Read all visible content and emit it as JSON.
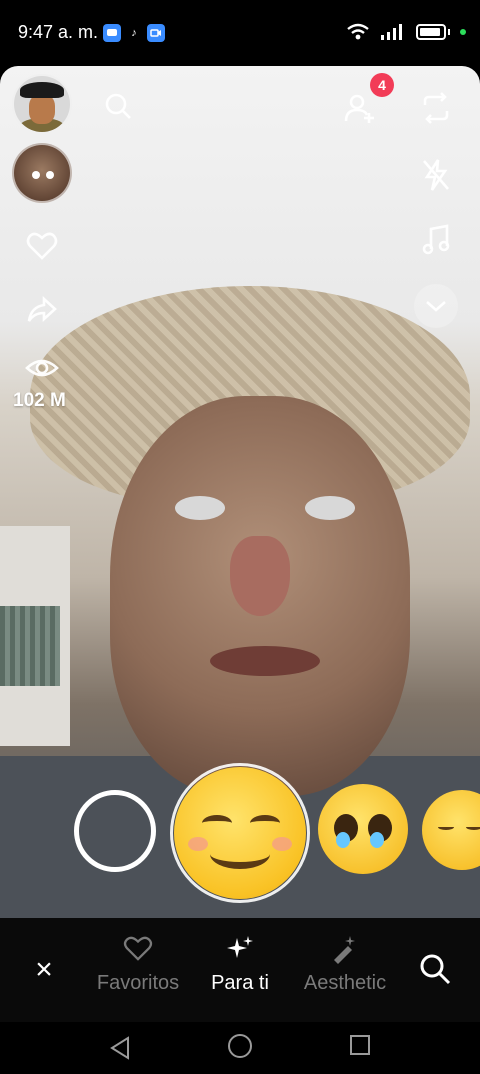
{
  "status_bar": {
    "time": "9:47 a. m.",
    "battery_icon": "battery-icon",
    "wifi_icon": "wifi-icon",
    "signal_icon": "signal-icon"
  },
  "camera": {
    "views_count": "102 M",
    "notification_badge": "4"
  },
  "bottom_nav": {
    "tabs": [
      {
        "label": "Favoritos",
        "icon": "heart-icon"
      },
      {
        "label": "Para ti",
        "icon": "sparkles-icon"
      },
      {
        "label": "Aesthetic",
        "icon": "magic-wand-icon"
      }
    ],
    "active_tab": "Para ti",
    "close_label": "×"
  },
  "colors": {
    "badge": "#f23c57",
    "active_tab": "#ffffff",
    "inactive_tab": "#7a7a7a"
  }
}
